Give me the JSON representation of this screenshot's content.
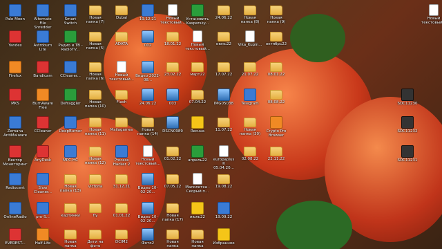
{
  "desktop": {
    "icons": [
      {
        "label": "Pale Moon",
        "icon": "palemoon-icon",
        "type": "app"
      },
      {
        "label": "Alternate File Shredder",
        "icon": "shredder-icon",
        "type": "app"
      },
      {
        "label": "Smart Switch",
        "icon": "smartswitch-icon",
        "type": "app"
      },
      {
        "label": "Новая папка (7)",
        "icon": "folder-icon",
        "type": "folder"
      },
      {
        "label": "Dubai",
        "icon": "folder-icon",
        "type": "folder"
      },
      {
        "label": "19.12.21",
        "icon": "info-icon",
        "type": "app"
      },
      {
        "label": "Новый текстовый...",
        "icon": "text-file-icon",
        "type": "doc"
      },
      {
        "label": "Установить Kaspersky...",
        "icon": "kaspersky-icon",
        "type": "green"
      },
      {
        "label": "24.06.22",
        "icon": "folder-icon",
        "type": "folder"
      },
      {
        "label": "Новая папка (8)",
        "icon": "folder-icon",
        "type": "folder"
      },
      {
        "label": "Новая папка (9)",
        "icon": "folder-icon",
        "type": "folder"
      },
      {
        "label": "Новый текстовый...",
        "icon": "text-file-icon",
        "type": "doc"
      },
      {
        "label": "Yandex",
        "icon": "yandex-icon",
        "type": "red"
      },
      {
        "label": "Astroburn Lite",
        "icon": "astroburn-icon",
        "type": "app"
      },
      {
        "label": "Радио и ТВ - RadioTV...",
        "icon": "radio-icon",
        "type": "green"
      },
      {
        "label": "Новая папка (5)",
        "icon": "folder-icon",
        "type": "folder"
      },
      {
        "label": "ADATA",
        "icon": "folder-icon",
        "type": "folder"
      },
      {
        "label": "002",
        "icon": "image-icon",
        "type": "img"
      },
      {
        "label": "18.01.22",
        "icon": "folder-icon",
        "type": "folder"
      },
      {
        "label": "Новый текстовый...",
        "icon": "text-file-icon",
        "type": "doc"
      },
      {
        "label": "июнь22",
        "icon": "folder-icon",
        "type": "folder"
      },
      {
        "label": "Vika_Kupin...",
        "icon": "text-file-icon",
        "type": "doc"
      },
      {
        "label": "октябрь22",
        "icon": "folder-icon",
        "type": "folder"
      },
      {
        "label": "Firefox",
        "icon": "firefox-icon",
        "type": "orange"
      },
      {
        "label": "Bandicam",
        "icon": "bandicam-icon",
        "type": "red"
      },
      {
        "label": "CCleaner...",
        "icon": "ccleaner-icon",
        "type": "app"
      },
      {
        "label": "Новая папка (6)",
        "icon": "folder-icon",
        "type": "folder"
      },
      {
        "label": "Новый текстовый...",
        "icon": "text-file-icon",
        "type": "doc"
      },
      {
        "label": "Видео 2022-08...",
        "icon": "video-icon",
        "type": "img"
      },
      {
        "label": "23.02.22",
        "icon": "folder-icon",
        "type": "folder"
      },
      {
        "label": "март22",
        "icon": "folder-icon",
        "type": "folder"
      },
      {
        "label": "17.07.22",
        "icon": "folder-icon",
        "type": "folder"
      },
      {
        "label": "21.07.22",
        "icon": "folder-icon",
        "type": "folder"
      },
      {
        "label": "08.01.22",
        "icon": "folder-icon",
        "type": "folder"
      },
      {
        "label": "MKS",
        "icon": "mks-icon",
        "type": "red"
      },
      {
        "label": "BurnAware Free",
        "icon": "burnaware-icon",
        "type": "orange"
      },
      {
        "label": "Defraggler",
        "icon": "defraggler-icon",
        "type": "green"
      },
      {
        "label": "Новая папка (10)",
        "icon": "folder-icon",
        "type": "folder"
      },
      {
        "label": "Flash",
        "icon": "folder-icon",
        "type": "folder"
      },
      {
        "label": "24.06.22",
        "icon": "image-icon",
        "type": "img"
      },
      {
        "label": "003",
        "icon": "image-icon",
        "type": "img"
      },
      {
        "label": "07.04.22",
        "icon": "folder-icon",
        "type": "folder"
      },
      {
        "label": "IMG05038",
        "icon": "image-icon",
        "type": "img"
      },
      {
        "label": "Telegram",
        "icon": "telegram-icon",
        "type": "app"
      },
      {
        "label": "08.08.22",
        "icon": "folder-icon",
        "type": "folder"
      },
      {
        "label": "SDC11230",
        "icon": "camera-image-icon",
        "type": "dark"
      },
      {
        "label": "Zemana AntiMalware",
        "icon": "zemana-icon",
        "type": "app"
      },
      {
        "label": "CCleaner",
        "icon": "ccleaner-icon",
        "type": "red"
      },
      {
        "label": "DeepBurner",
        "icon": "deepburner-icon",
        "type": "app"
      },
      {
        "label": "Новая папка (11)",
        "icon": "folder-icon",
        "type": "folder"
      },
      {
        "label": "Mailagames",
        "icon": "folder-icon",
        "type": "folder"
      },
      {
        "label": "Новая папка (14)",
        "icon": "folder-icon",
        "type": "folder"
      },
      {
        "label": "DSCN0989",
        "icon": "image-icon",
        "type": "img"
      },
      {
        "label": "Recuva",
        "icon": "recuva-icon",
        "type": "yellow"
      },
      {
        "label": "11.07.22",
        "icon": "folder-icon",
        "type": "folder"
      },
      {
        "label": "Новая папка (30)",
        "icon": "folder-icon",
        "type": "folder"
      },
      {
        "label": "Crypto Pro Browser",
        "icon": "cryptopro-icon",
        "type": "orange"
      },
      {
        "label": "SDC11232",
        "icon": "camera-image-icon",
        "type": "dark"
      },
      {
        "label": "Вектор Мониторинг...",
        "icon": "vector-icon",
        "type": "red"
      },
      {
        "label": "AnyDesk",
        "icon": "anydesk-icon",
        "type": "red"
      },
      {
        "label": "MPC-HC",
        "icon": "mpchc-icon",
        "type": "app"
      },
      {
        "label": "Новая папка (12)",
        "icon": "folder-icon",
        "type": "folder"
      },
      {
        "label": "Process Hacker 2",
        "icon": "processhacker-icon",
        "type": "app"
      },
      {
        "label": "Новый текстовый...",
        "icon": "text-file-icon",
        "type": "doc"
      },
      {
        "label": "01.02.22",
        "icon": "folder-icon",
        "type": "folder"
      },
      {
        "label": "апрель22",
        "icon": "green-flag-icon",
        "type": "green"
      },
      {
        "label": "europaplus © 05.04.20...",
        "icon": "text-file-icon",
        "type": "doc"
      },
      {
        "label": "02.08.22",
        "icon": "folder-icon",
        "type": "folder"
      },
      {
        "label": "22.11.22",
        "icon": "folder-icon",
        "type": "folder"
      },
      {
        "label": "SDC11231",
        "icon": "camera-image-icon",
        "type": "dark"
      },
      {
        "label": "Radiocent",
        "icon": "radiocent-icon",
        "type": "app"
      },
      {
        "label": "Slow Cleaner...",
        "icon": "slowcleaner-icon",
        "type": "app"
      },
      {
        "label": "Новая папка (13)",
        "icon": "folder-icon",
        "type": "folder"
      },
      {
        "label": "victoria",
        "icon": "folder-icon",
        "type": "folder"
      },
      {
        "label": "31.12.21",
        "icon": "folder-icon",
        "type": "folder"
      },
      {
        "label": "Видео 10-02-20...",
        "icon": "video-icon",
        "type": "img"
      },
      {
        "label": "07.05.22",
        "icon": "folder-icon",
        "type": "folder"
      },
      {
        "label": "Малолетка - Скорый п...",
        "icon": "audio-file-icon",
        "type": "doc"
      },
      {
        "label": "19.08.22",
        "icon": "folder-icon",
        "type": "folder"
      },
      {
        "label": "OnlineRadio",
        "icon": "onlineradio-icon",
        "type": "app"
      },
      {
        "label": "pro-S...",
        "icon": "pros-icon",
        "type": "app"
      },
      {
        "label": "картинки",
        "icon": "folder-icon",
        "type": "folder"
      },
      {
        "label": "fly",
        "icon": "folder-icon",
        "type": "folder"
      },
      {
        "label": "01.01.22",
        "icon": "folder-icon",
        "type": "folder"
      },
      {
        "label": "Видео 10-02-20...",
        "icon": "video-icon",
        "type": "img"
      },
      {
        "label": "Новая папка (17)",
        "icon": "folder-icon",
        "type": "folder"
      },
      {
        "label": "июль22",
        "icon": "shield-warning-icon",
        "type": "yellow"
      },
      {
        "label": "19.09.22",
        "icon": "power-icon",
        "type": "app"
      },
      {
        "label": "EVEREST...",
        "icon": "everest-icon",
        "type": "red"
      },
      {
        "label": "Half-Life",
        "icon": "halflife-icon",
        "type": "orange"
      },
      {
        "label": "Новая папка",
        "icon": "folder-icon",
        "type": "folder"
      },
      {
        "label": "Дети на фото",
        "icon": "folder-icon",
        "type": "folder"
      },
      {
        "label": "DCIM2",
        "icon": "folder-icon",
        "type": "folder"
      },
      {
        "label": "Фото2",
        "icon": "image-icon",
        "type": "img"
      },
      {
        "label": "Новая папка",
        "icon": "folder-icon",
        "type": "folder"
      },
      {
        "label": "Новая папка",
        "icon": "folder-icon",
        "type": "folder"
      },
      {
        "label": "Избранное",
        "icon": "star-icon",
        "type": "yellow"
      }
    ]
  }
}
